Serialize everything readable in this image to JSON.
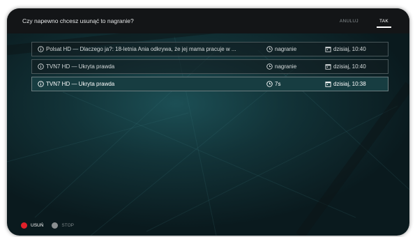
{
  "dialog": {
    "question": "Czy napewno chcesz usunąć to nagranie?",
    "cancel_label": "ANULUJ",
    "confirm_label": "TAK"
  },
  "recordings": [
    {
      "title": "Polsat HD — Dlaczego ja?: 18-letnia Ania odkrywa, że jej mama pracuje w ...",
      "status": "nagranie",
      "date": "dzisiaj, 10:40",
      "selected": false
    },
    {
      "title": "TVN7 HD — Ukryta prawda",
      "status": "nagranie",
      "date": "dzisiaj, 10:40",
      "selected": false
    },
    {
      "title": "TVN7 HD — Ukryta prawda",
      "status": "7s",
      "date": "dzisiaj, 10:38",
      "selected": true
    }
  ],
  "footer": {
    "red_label": "USUŃ",
    "grey_label": "STOP"
  },
  "colors": {
    "red_button": "#e0202a",
    "grey_button": "#8a8f91"
  },
  "icons": {
    "title": "info-circle-icon",
    "status": "clock-icon",
    "date": "calendar-icon"
  }
}
